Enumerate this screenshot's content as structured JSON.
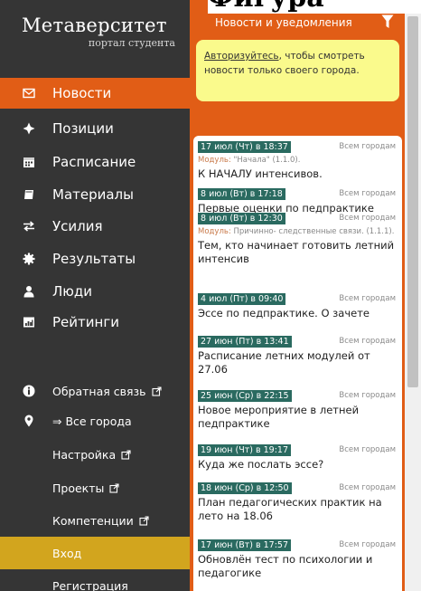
{
  "cut_heading": "Фигура",
  "logo": {
    "title": "Метаверситет",
    "subtitle": "портал студента"
  },
  "main_nav": [
    {
      "label": "Новости",
      "icon": "mail-icon",
      "active": true
    },
    {
      "label": "Позиции",
      "icon": "compass-icon"
    },
    {
      "label": "Расписание",
      "icon": "calendar-icon"
    },
    {
      "label": "Материалы",
      "icon": "book-icon"
    },
    {
      "label": "Усилия",
      "icon": "exchange-icon"
    },
    {
      "label": "Результаты",
      "icon": "gear-icon"
    },
    {
      "label": "Люди",
      "icon": "user-icon"
    },
    {
      "label": "Рейтинги",
      "icon": "bar-chart-icon"
    }
  ],
  "secondary_nav": [
    {
      "label": "Обратная связь",
      "icon": "info-icon",
      "external": true
    },
    {
      "label": "⇒ Все города",
      "icon": "map-marker-icon"
    },
    {
      "label": "Настройка",
      "external": true
    },
    {
      "label": "Проекты",
      "external": true
    },
    {
      "label": "Компетенции",
      "external": true
    },
    {
      "label": "Вход",
      "highlight": true
    },
    {
      "label": "Регистрация"
    }
  ],
  "news_header": {
    "title": "Новости и уведомления",
    "icon": "filter-icon"
  },
  "auth_notice": {
    "link": "Авторизуйтесь",
    "text": ", чтобы смотреть новости только своего города."
  },
  "news": [
    {
      "date": "17 июл (Чт) в 18:37",
      "scope": "Всем городам",
      "module_label": "Модуль:",
      "module": " \"Начала\" (1.1.0).",
      "title": "К НАЧАЛУ интенсивов."
    },
    {
      "date": "8 июл (Вт) в 17:18",
      "scope": "Всем городам",
      "title": "Первые оценки по педпрактике"
    },
    {
      "date": "8 июл (Вт) в 12:30",
      "scope": "Всем городам",
      "module_label": "Модуль:",
      "module": " Причинно- следственные связи. (1.1.1).",
      "title": "Тем, кто начинает готовить летний интенсив"
    },
    {
      "date": "4 июл (Пт) в 09:40",
      "scope": "Всем городам",
      "title": "Эссе по педпрактике. О зачете"
    },
    {
      "date": "27 июн (Пт) в 13:41",
      "scope": "Всем городам",
      "title": "Расписание летних модулей от 27.06"
    },
    {
      "date": "25 июн (Ср) в 22:15",
      "scope": "Всем городам",
      "title": "Новое мероприятие в летней педпрактике"
    },
    {
      "date": "19 июн (Чт) в 19:17",
      "scope": "Всем городам",
      "title": "Куда же послать эссе?"
    },
    {
      "date": "18 июн (Ср) в 12:50",
      "scope": "Всем городам",
      "title": "План педагогических практик на лето на 18.06"
    },
    {
      "date": "17 июн (Вт) в 17:57",
      "scope": "Всем городам",
      "title": "Обновлён тест по психологии и педагогике"
    }
  ],
  "colors": {
    "sidebar": "#353535",
    "accent": "#e15d16",
    "highlight": "#d2a51e",
    "notice": "#fafa8c",
    "badge": "#2a6a60"
  }
}
